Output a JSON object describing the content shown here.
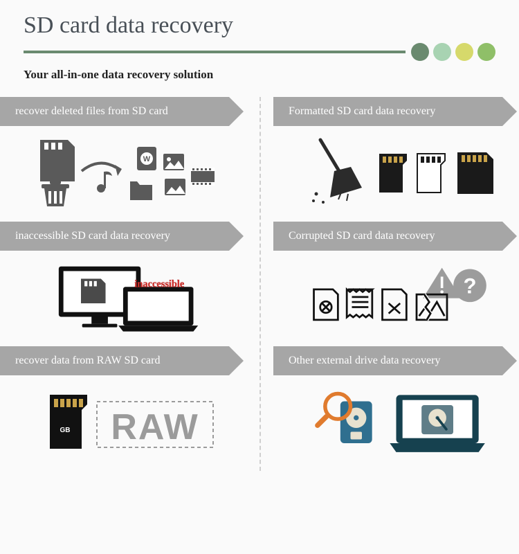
{
  "header": {
    "title": "SD card data recovery",
    "subtitle": "Your all-in-one data recovery solution"
  },
  "dot_colors": [
    "#6a8a6f",
    "#a8d3b2",
    "#d6d96b",
    "#8fbf68"
  ],
  "cells": {
    "deleted": {
      "banner": "recover deleted files from SD card"
    },
    "formatted": {
      "banner": "Formatted SD card data recovery"
    },
    "inaccessible": {
      "banner": "inaccessible SD card data recovery",
      "label": "inaccessible"
    },
    "corrupted": {
      "banner": "Corrupted SD card data recovery"
    },
    "raw": {
      "banner": "recover data from RAW SD card",
      "gb": "GB",
      "raw_label": "RAW"
    },
    "other": {
      "banner": "Other external drive data recovery"
    }
  }
}
